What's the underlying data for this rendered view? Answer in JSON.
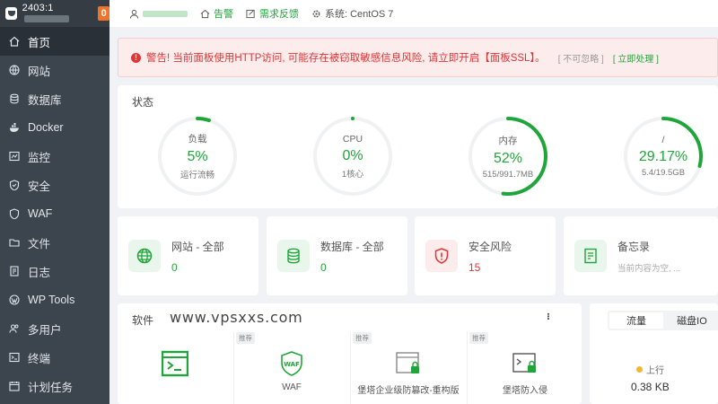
{
  "sidebar": {
    "ip_prefix": "2403:1",
    "badge": "0",
    "items": [
      {
        "label": "首页",
        "icon": "home-icon"
      },
      {
        "label": "网站",
        "icon": "globe-icon"
      },
      {
        "label": "数据库",
        "icon": "database-icon"
      },
      {
        "label": "Docker",
        "icon": "docker-icon"
      },
      {
        "label": "监控",
        "icon": "monitor-icon"
      },
      {
        "label": "安全",
        "icon": "shield-icon"
      },
      {
        "label": "WAF",
        "icon": "waf-shield-icon"
      },
      {
        "label": "文件",
        "icon": "folder-icon"
      },
      {
        "label": "日志",
        "icon": "log-icon"
      },
      {
        "label": "WP Tools",
        "icon": "wordpress-icon"
      },
      {
        "label": "多用户",
        "icon": "users-icon"
      },
      {
        "label": "终端",
        "icon": "terminal-icon"
      },
      {
        "label": "计划任务",
        "icon": "calendar-icon"
      }
    ]
  },
  "topbar": {
    "alarm": "告警",
    "feedback": "需求反馈",
    "system": "系统: CentOS 7"
  },
  "alert": {
    "message": "警告! 当前面板使用HTTP访问, 可能存在被窃取敏感信息风险, 请立即开启【面板SSL】。",
    "ignore": "[ 不可忽略 ]",
    "fix": "[ 立即处理 ]"
  },
  "status": {
    "title": "状态",
    "gauges": [
      {
        "name": "负载",
        "value": "5%",
        "sub": "运行流畅",
        "fraction": 0.05
      },
      {
        "name": "CPU",
        "value": "0%",
        "sub": "1核心",
        "fraction": 0.0
      },
      {
        "name": "内存",
        "value": "52%",
        "sub": "515/991.7MB",
        "fraction": 0.52
      },
      {
        "name": "/",
        "value": "29.17%",
        "sub": "5.4/19.5GB",
        "fraction": 0.2917
      }
    ],
    "accent": "#20a53a",
    "track": "#f0f1f3"
  },
  "overview": [
    {
      "title": "网站 - 全部",
      "value": "0"
    },
    {
      "title": "数据库 - 全部",
      "value": "0"
    },
    {
      "title": "安全风险",
      "value": "15"
    },
    {
      "title": "备忘录",
      "value": "当前内容为空, ..."
    }
  ],
  "software": {
    "title": "软件",
    "watermark": "www.vpsxxs.com",
    "items": [
      {
        "name": "",
        "tag": ""
      },
      {
        "name": "WAF",
        "tag": "推荐"
      },
      {
        "name": "堡塔企业级防篡改-重构版",
        "tag": "推荐"
      },
      {
        "name": "堡塔防入侵",
        "tag": "推荐"
      }
    ]
  },
  "traffic": {
    "tabs": [
      "流量",
      "磁盘IO"
    ],
    "up_label": "上行",
    "up_value": "0.38 KB"
  }
}
